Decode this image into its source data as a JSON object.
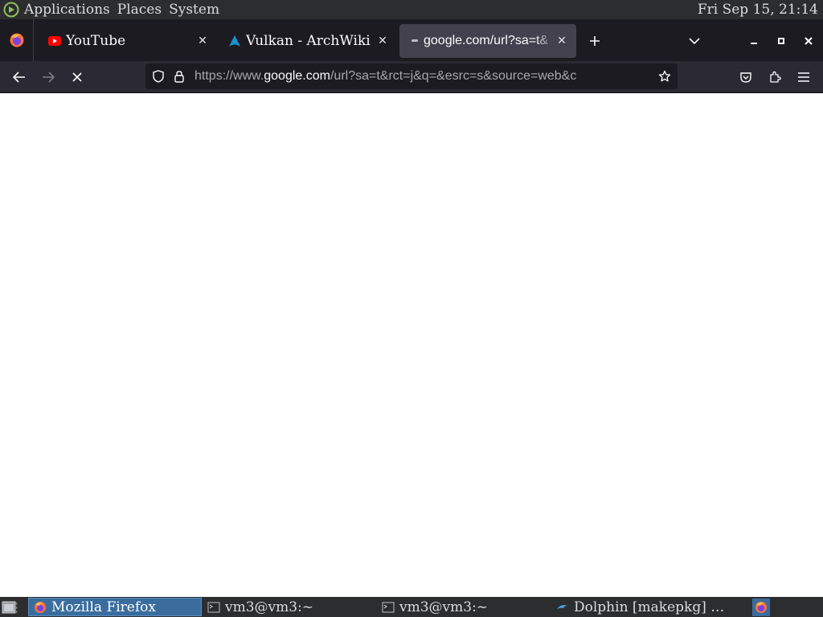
{
  "top_panel": {
    "menus": [
      "Applications",
      "Places",
      "System"
    ],
    "clock": "Fri Sep 15, 21:14"
  },
  "browser": {
    "tabs": [
      {
        "title": "YouTube",
        "favicon": "youtube-icon",
        "active": false
      },
      {
        "title": "Vulkan - ArchWiki",
        "favicon": "archlinux-icon",
        "active": false
      },
      {
        "title": "google.com/url?sa=t&",
        "favicon": "loading-dot-icon",
        "active": true
      }
    ],
    "url": {
      "prefix": "https://www.",
      "domain": "google.com",
      "rest": "/url?sa=t&rct=j&q=&esrc=s&source=web&c"
    },
    "page_loading": true
  },
  "taskbar": {
    "tasks": [
      {
        "label": "Mozilla Firefox",
        "icon": "firefox-icon",
        "active": true
      },
      {
        "label": "vm3@vm3:~",
        "icon": "terminal-icon",
        "active": false
      },
      {
        "label": "vm3@vm3:~",
        "icon": "terminal-icon",
        "active": false
      },
      {
        "label": "Dolphin [makepkg] …",
        "icon": "dolphin-icon",
        "active": false
      }
    ]
  },
  "colors": {
    "panel_bg": "#2b2d2f",
    "tabstrip_bg": "#1c1b22",
    "active_tab_bg": "#42414d",
    "navbar_bg": "#2b2a33",
    "taskbar_active": "#3a6d9e"
  }
}
